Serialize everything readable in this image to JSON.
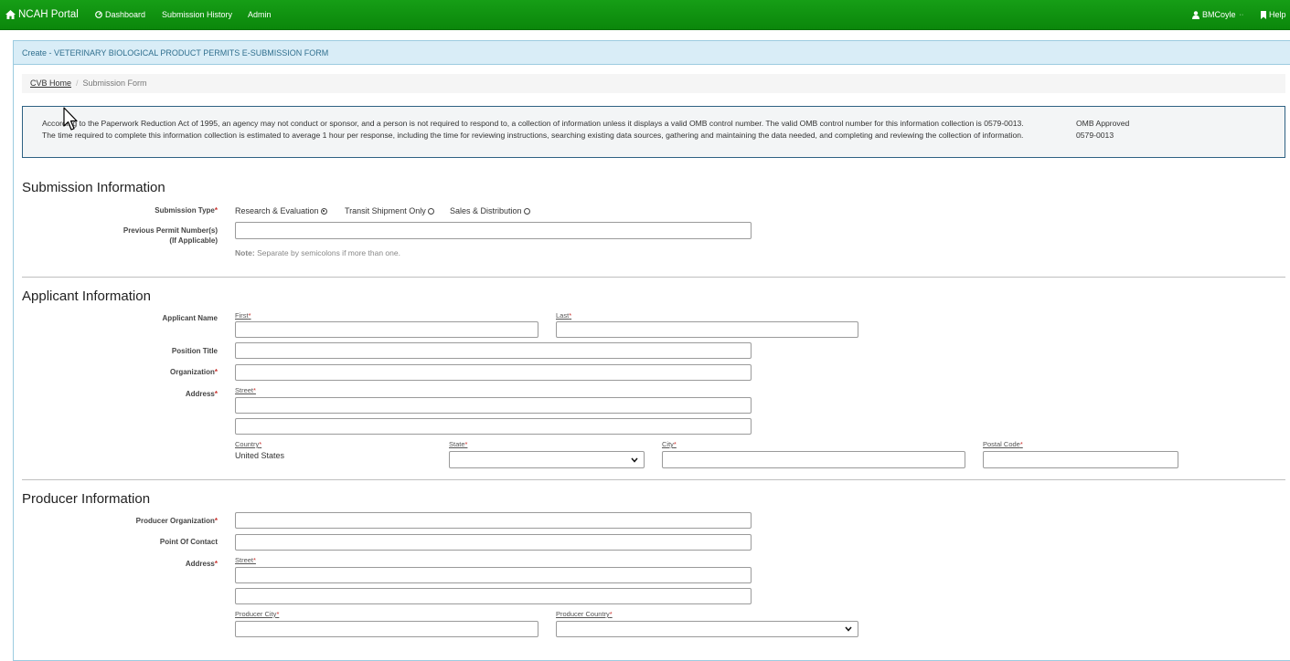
{
  "navbar": {
    "brand": "NCAH Portal",
    "dashboard": "Dashboard",
    "submission_history": "Submission History",
    "admin": "Admin",
    "user": "BMCoyle",
    "help": "Help",
    "bg_color": "#0f8f0f",
    "icons": [
      "home-icon",
      "dashboard-icon",
      "user-icon",
      "bookmark-icon"
    ]
  },
  "panel": {
    "heading": "Create - VETERINARY BIOLOGICAL PRODUCT PERMITS E-SUBMISSION FORM"
  },
  "breadcrumb": {
    "home": "CVB Home",
    "current": "Submission Form"
  },
  "notice": {
    "line1": "According to the Paperwork Reduction Act of 1995, an agency may not conduct or sponsor, and a person is not required to respond to, a collection of information unless it displays a valid OMB control number. The valid OMB control number for this information collection is 0579-0013.",
    "line2": "The time required to complete this information collection is estimated to average 1 hour per response, including the time for reviewing instructions, searching existing data sources, gathering and maintaining the data needed, and completing and reviewing the collection of information.",
    "omb_label": "OMB Approved",
    "omb_number": "0579-0013"
  },
  "submission": {
    "title": "Submission Information",
    "type_label": "Submission Type",
    "options": [
      "Research & Evaluation",
      "Transit Shipment Only",
      "Sales & Distribution"
    ],
    "selected": "Research & Evaluation",
    "prev_label_1": "Previous Permit Number(s)",
    "prev_label_2": "(If Applicable)",
    "prev_value": "",
    "note_bold": "Note:",
    "note_text": "Separate by semicolons if more than one."
  },
  "applicant": {
    "title": "Applicant Information",
    "name_label": "Applicant Name",
    "first_label": "First",
    "last_label": "Last",
    "position_label": "Position Title",
    "org_label": "Organization",
    "address_label": "Address",
    "street_label": "Street",
    "country_label": "Country",
    "country_value": "United States",
    "state_label": "State",
    "state_value": "",
    "city_label": "City",
    "postal_label": "Postal Code"
  },
  "producer": {
    "title": "Producer Information",
    "org_label": "Producer Organization",
    "poc_label": "Point Of Contact",
    "address_label": "Address",
    "street_label": "Street",
    "city_label": "Producer City",
    "country_label": "Producer Country",
    "country_value": ""
  },
  "required_marker": "*",
  "accent_colors": {
    "panel_heading_bg": "#d9edf7",
    "panel_heading_text": "#31708f",
    "required": "#c9302c"
  }
}
